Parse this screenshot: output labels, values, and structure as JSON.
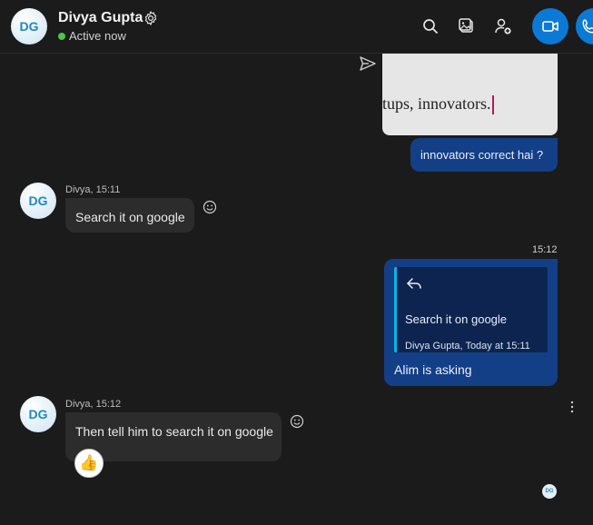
{
  "header": {
    "avatar_initials": "DG",
    "contact_name": "Divya Gupta",
    "status": "Active now",
    "status_color": "#4cc54c",
    "icons": [
      "gear-icon",
      "search-icon",
      "gallery-icon",
      "add-person-icon",
      "video-call-icon",
      "audio-call-icon"
    ]
  },
  "colors": {
    "background": "#1b1b1b",
    "outgoing_bubble": "#133f87",
    "incoming_bubble": "#2c2c2c",
    "accent": "#0b79d6"
  },
  "messages": [
    {
      "type": "outgoing-image",
      "image_text": "tups, innovators."
    },
    {
      "type": "outgoing",
      "text": "innovators correct hai ?"
    },
    {
      "type": "incoming",
      "avatar_initials": "DG",
      "sender": "Divya, 15:11",
      "text": "Search it on google"
    },
    {
      "type": "outgoing-reply",
      "time": "15:12",
      "quoted_text": "Search it on google",
      "quoted_meta": "Divya Gupta, Today at 15:11",
      "text": "Alim is asking"
    },
    {
      "type": "incoming",
      "avatar_initials": "DG",
      "sender": "Divya, 15:12",
      "text": "Then tell him to search it on google",
      "reaction": "👍"
    }
  ],
  "read_receipt_initials": "DG"
}
